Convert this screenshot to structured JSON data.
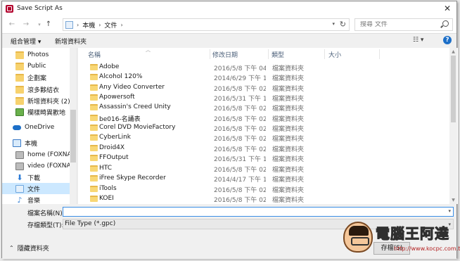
{
  "window": {
    "title": "Save Script As"
  },
  "navigation": {
    "breadcrumb": [
      "本機",
      "文件"
    ],
    "search_placeholder": "搜尋 文件"
  },
  "toolbar": {
    "organize_label": "組合管理 ▾",
    "new_folder_label": "新增資料夾"
  },
  "sidebar": {
    "items": [
      {
        "label": "Photos",
        "icon": "folder-icon"
      },
      {
        "label": "Public",
        "icon": "folder-icon"
      },
      {
        "label": "企劃案",
        "icon": "folder-icon"
      },
      {
        "label": "滾多夥結衣",
        "icon": "folder-icon"
      },
      {
        "label": "新增資料夾 (2)",
        "icon": "folder-icon"
      },
      {
        "label": "欄樣畸異歡地",
        "icon": "image-folder-icon"
      },
      {
        "label": "OneDrive",
        "icon": "onedrive-icon"
      },
      {
        "label": "本機",
        "icon": "this-pc-icon"
      },
      {
        "label": "home (FOXNA",
        "icon": "network-drive-icon"
      },
      {
        "label": "video (FOXNA",
        "icon": "network-drive-icon"
      },
      {
        "label": "下載",
        "icon": "download-icon"
      },
      {
        "label": "文件",
        "icon": "documents-icon"
      },
      {
        "label": "音樂",
        "icon": "music-icon"
      }
    ]
  },
  "file_list": {
    "columns": [
      "名稱",
      "修改日期",
      "類型",
      "大小"
    ],
    "rows": [
      {
        "name": "Adobe",
        "date": "2016/5/8 下午 04...",
        "type": "檔案資料夾"
      },
      {
        "name": "Alcohol 120%",
        "date": "2014/6/29 下午 1...",
        "type": "檔案資料夾"
      },
      {
        "name": "Any Video Converter",
        "date": "2016/5/8 下午 02...",
        "type": "檔案資料夾"
      },
      {
        "name": "Apowersoft",
        "date": "2016/5/31 下午 1...",
        "type": "檔案資料夾"
      },
      {
        "name": "Assassin's Creed Unity",
        "date": "2016/5/8 下午 02...",
        "type": "檔案資料夾"
      },
      {
        "name": "be016-名誦表",
        "date": "2016/5/8 下午 02...",
        "type": "檔案資料夾"
      },
      {
        "name": "Corel DVD MovieFactory",
        "date": "2016/5/8 下午 02...",
        "type": "檔案資料夾"
      },
      {
        "name": "CyberLink",
        "date": "2016/5/8 下午 02...",
        "type": "檔案資料夾"
      },
      {
        "name": "Droid4X",
        "date": "2016/5/8 下午 02...",
        "type": "檔案資料夾"
      },
      {
        "name": "FFOutput",
        "date": "2016/5/31 下午 1...",
        "type": "檔案資料夾"
      },
      {
        "name": "HTC",
        "date": "2016/5/8 下午 02...",
        "type": "檔案資料夾"
      },
      {
        "name": "iFree Skype Recorder",
        "date": "2014/4/17 下午 1...",
        "type": "檔案資料夾"
      },
      {
        "name": "iTools",
        "date": "2016/5/8 下午 02...",
        "type": "檔案資料夾"
      },
      {
        "name": "KOEI",
        "date": "2016/5/8 下午 02...",
        "type": "檔案資料夾"
      }
    ]
  },
  "form": {
    "filename_label": "檔案名稱(N):",
    "filename_value": "",
    "filetype_label": "存檔類型(T):",
    "filetype_value": "File Type (*.gpc)"
  },
  "footer": {
    "hide_folders_label": "隱藏資料夾",
    "save_partial_label": "存檔(S)"
  },
  "watermark": {
    "title": "電腦王阿達",
    "url": "http://www.kocpc.com.tw"
  },
  "colors": {
    "selection": "#cce8ff",
    "accent": "#1d6fc8",
    "app_icon": "#b2002d"
  }
}
